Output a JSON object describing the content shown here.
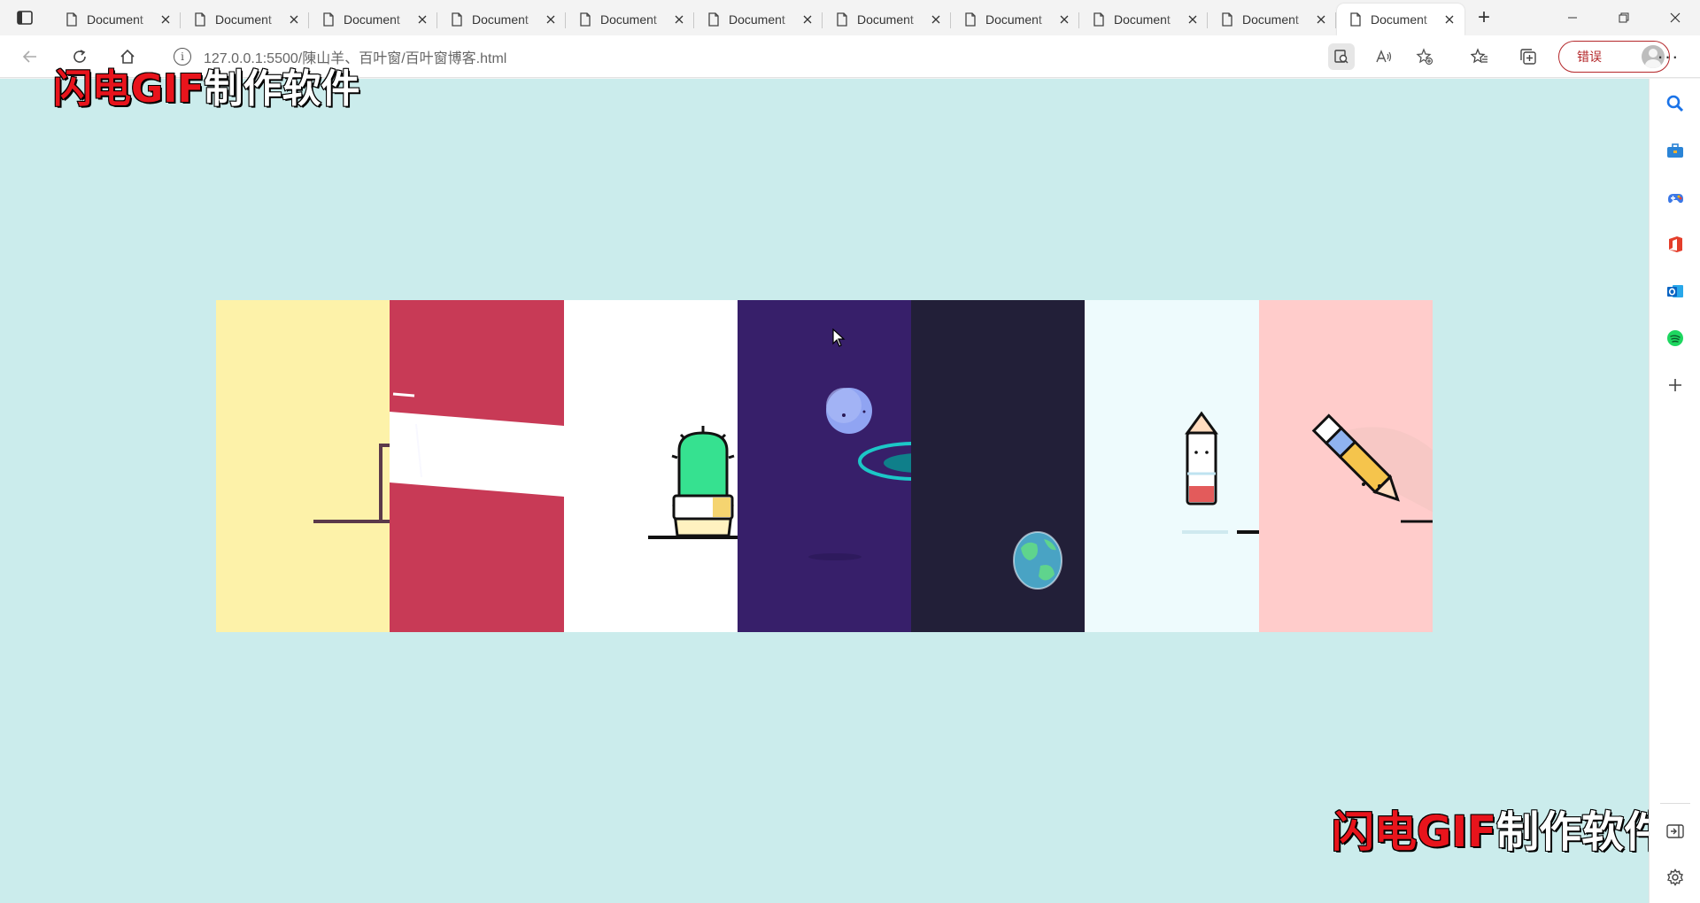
{
  "browser": {
    "tabs": [
      {
        "title": "Document",
        "active": false
      },
      {
        "title": "Document",
        "active": false
      },
      {
        "title": "Document",
        "active": false
      },
      {
        "title": "Document",
        "active": false
      },
      {
        "title": "Document",
        "active": false
      },
      {
        "title": "Document",
        "active": false
      },
      {
        "title": "Document",
        "active": false
      },
      {
        "title": "Document",
        "active": false
      },
      {
        "title": "Document",
        "active": false
      },
      {
        "title": "Document",
        "active": false
      },
      {
        "title": "Document",
        "active": true
      }
    ],
    "new_tab_label": "+",
    "url": "127.0.0.1:5500/陳山羊、百叶窗/百叶窗博客.html",
    "profile_status": "错误",
    "more_label": "···"
  },
  "page": {
    "background": "#cbecec",
    "panels": [
      {
        "color": "#fdf2a9",
        "illustration": "desk-shelf"
      },
      {
        "color": "#c83a56",
        "illustration": "sliding-slats"
      },
      {
        "color": "#ffffff",
        "illustration": "cactus-pot"
      },
      {
        "color": "#371f6a",
        "illustration": "planet-with-ring"
      },
      {
        "color": "#221f38",
        "illustration": "earth-globe"
      },
      {
        "color": "#eefbfd",
        "illustration": "pencil-upright"
      },
      {
        "color": "#ffcccb",
        "illustration": "pencil-writing"
      }
    ]
  },
  "watermark": {
    "red_text": "闪电GIF",
    "white_text": "制作软件"
  },
  "sidebar": {
    "icons": [
      "search-icon",
      "toolbox-icon",
      "games-icon",
      "office-icon",
      "outlook-icon",
      "spotify-icon",
      "add-icon",
      "hide-sidebar-icon",
      "settings-icon"
    ]
  }
}
